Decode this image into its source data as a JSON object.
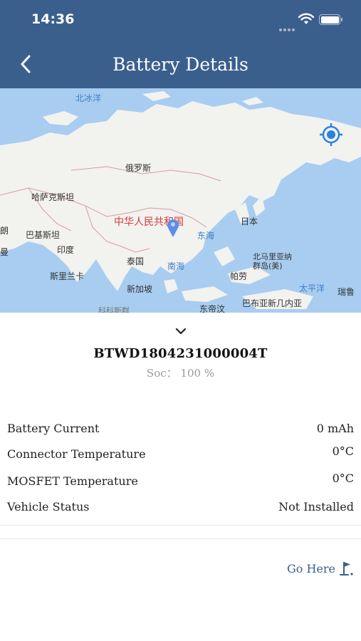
{
  "status_bar": {
    "time": "14:36"
  },
  "nav": {
    "title": "Battery Details"
  },
  "map": {
    "labels": {
      "arctic": "北冰洋",
      "russia": "俄罗斯",
      "kazakhstan": "哈萨克斯坦",
      "pakistan": "巴基斯坦",
      "india": "印度",
      "china": "中华人民共和国",
      "japan": "日本",
      "east_sea": "东海",
      "south_sea": "南海",
      "thailand": "泰国",
      "sri_lanka": "斯里兰卡",
      "singapore": "新加坡",
      "philippines_marianas": "北马里亚纳群岛(美)",
      "palau": "帕劳",
      "pacific": "太平洋",
      "ruiru": "瑞鲁",
      "east_timor": "东帝汶",
      "png": "巴布亚新几内亚",
      "colombo": "科科斯群",
      "edge_iran": "朗",
      "edge_a": "曼"
    }
  },
  "battery": {
    "id": "BTWD1804231000004T",
    "soc_label": "Soc：",
    "soc_value": "100 %"
  },
  "details": [
    {
      "label": "Battery Current",
      "value": "0 mAh"
    },
    {
      "label": "Connector Temperature",
      "value": "0°C"
    },
    {
      "label": "MOSFET Temperature",
      "value": "0°C"
    },
    {
      "label": "Vehicle Status",
      "value": "Not Installed"
    }
  ],
  "actions": {
    "go_here": "Go Here"
  },
  "colors": {
    "header": "#3b5f8d",
    "sea": "#a8cdf1",
    "land": "#f2f2ef",
    "accent": "#2c82e0"
  },
  "icons": [
    "back-chevron-icon",
    "wifi-icon",
    "battery-icon",
    "locate-icon",
    "map-pin-icon",
    "chevron-down-icon",
    "flag-icon"
  ]
}
